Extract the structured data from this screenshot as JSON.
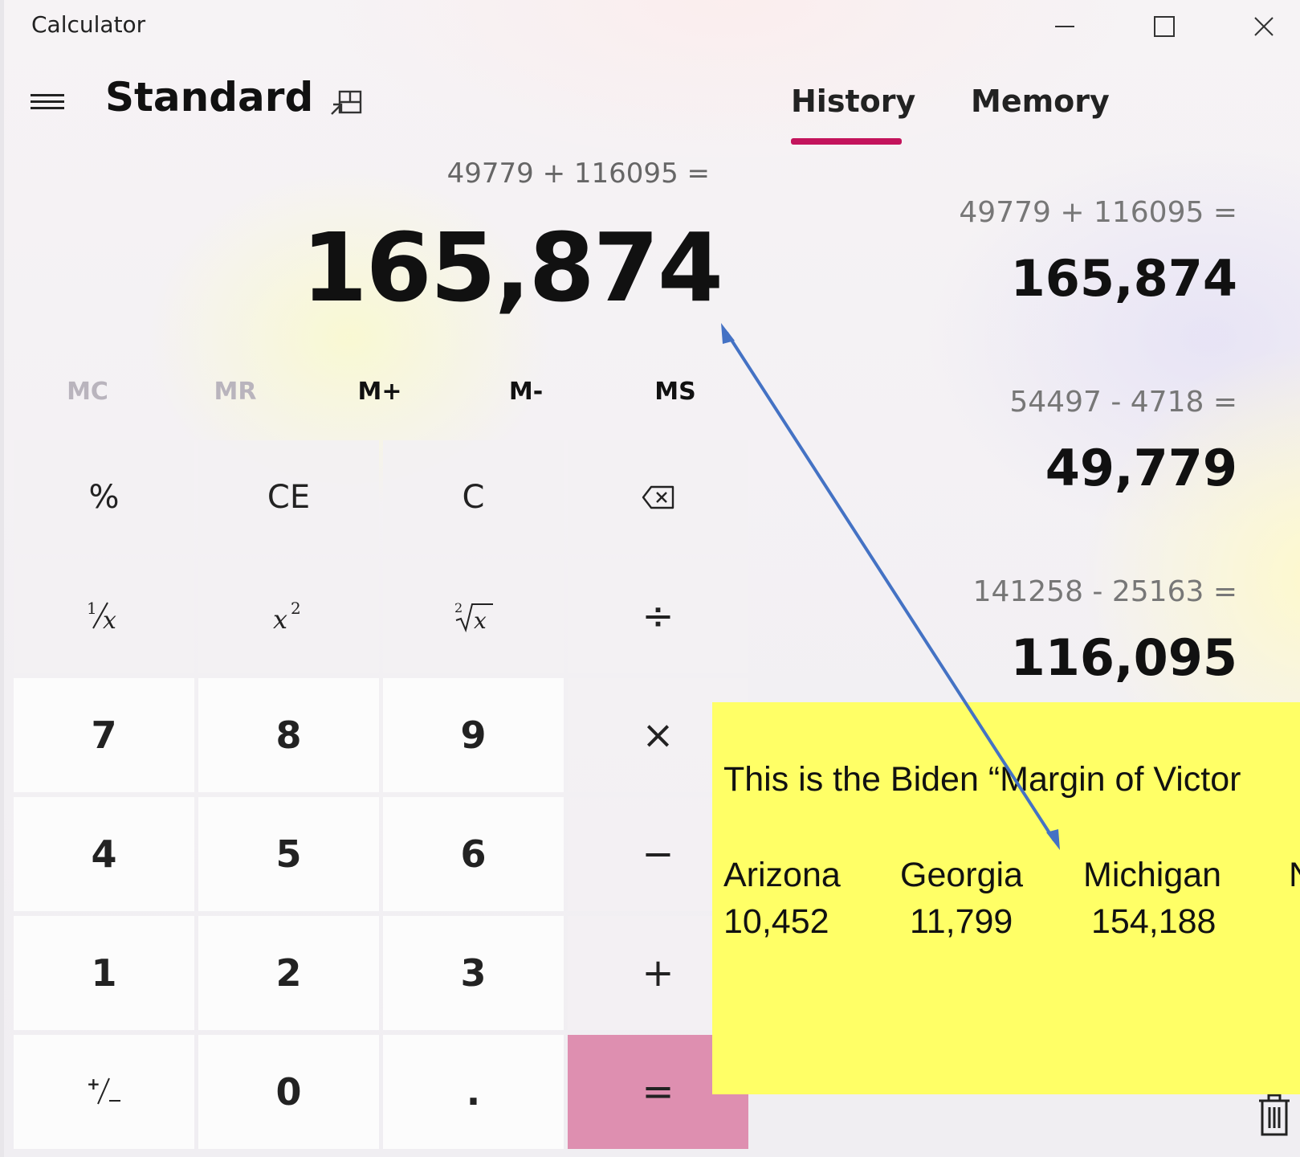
{
  "window": {
    "title": "Calculator",
    "controls": [
      "minimize-icon",
      "maximize-icon",
      "close-icon"
    ]
  },
  "header": {
    "mode": "Standard",
    "tabs": [
      {
        "label": "History",
        "active": true
      },
      {
        "label": "Memory",
        "active": false
      }
    ],
    "accent_color": "#c3145c"
  },
  "display": {
    "expression": "49779 + 116095 =",
    "result": "165,874"
  },
  "memory": [
    {
      "label": "MC",
      "enabled": false
    },
    {
      "label": "MR",
      "enabled": false
    },
    {
      "label": "M+",
      "enabled": true
    },
    {
      "label": "M-",
      "enabled": true
    },
    {
      "label": "MS",
      "enabled": true
    }
  ],
  "keypad": {
    "rows": [
      [
        "%",
        "CE",
        "C",
        "backspace-icon"
      ],
      [
        "1/x",
        "x²",
        "√x",
        "÷"
      ],
      [
        "7",
        "8",
        "9",
        "×"
      ],
      [
        "4",
        "5",
        "6",
        "−"
      ],
      [
        "1",
        "2",
        "3",
        "+"
      ],
      [
        "+/−",
        "0",
        ".",
        "="
      ]
    ],
    "labels": {
      "percent": "%",
      "ce": "CE",
      "c": "C",
      "divide": "÷",
      "multiply": "×",
      "minus": "−",
      "plus": "+",
      "equals": "=",
      "seven": "7",
      "eight": "8",
      "nine": "9",
      "four": "4",
      "five": "5",
      "six": "6",
      "one": "1",
      "two": "2",
      "three": "3",
      "zero": "0",
      "decimal": "."
    },
    "equals_color": "#de8fb0"
  },
  "history": [
    {
      "expression": "49779   +   116095 =",
      "result": "165,874"
    },
    {
      "expression": "54497   -   4718 =",
      "result": "49,779"
    },
    {
      "expression": "141258   -   25163 =",
      "result": "116,095"
    }
  ],
  "annotation": {
    "text": "This is the Biden “Margin of Victor",
    "states": [
      {
        "name": "Arizona",
        "margin": "10,452"
      },
      {
        "name": "Georgia",
        "margin": "11,799"
      },
      {
        "name": "Michigan",
        "margin": "154,188"
      },
      {
        "name": "N",
        "margin": ""
      }
    ],
    "background_color": "#ffff66",
    "arrow_color": "#4472c4"
  }
}
